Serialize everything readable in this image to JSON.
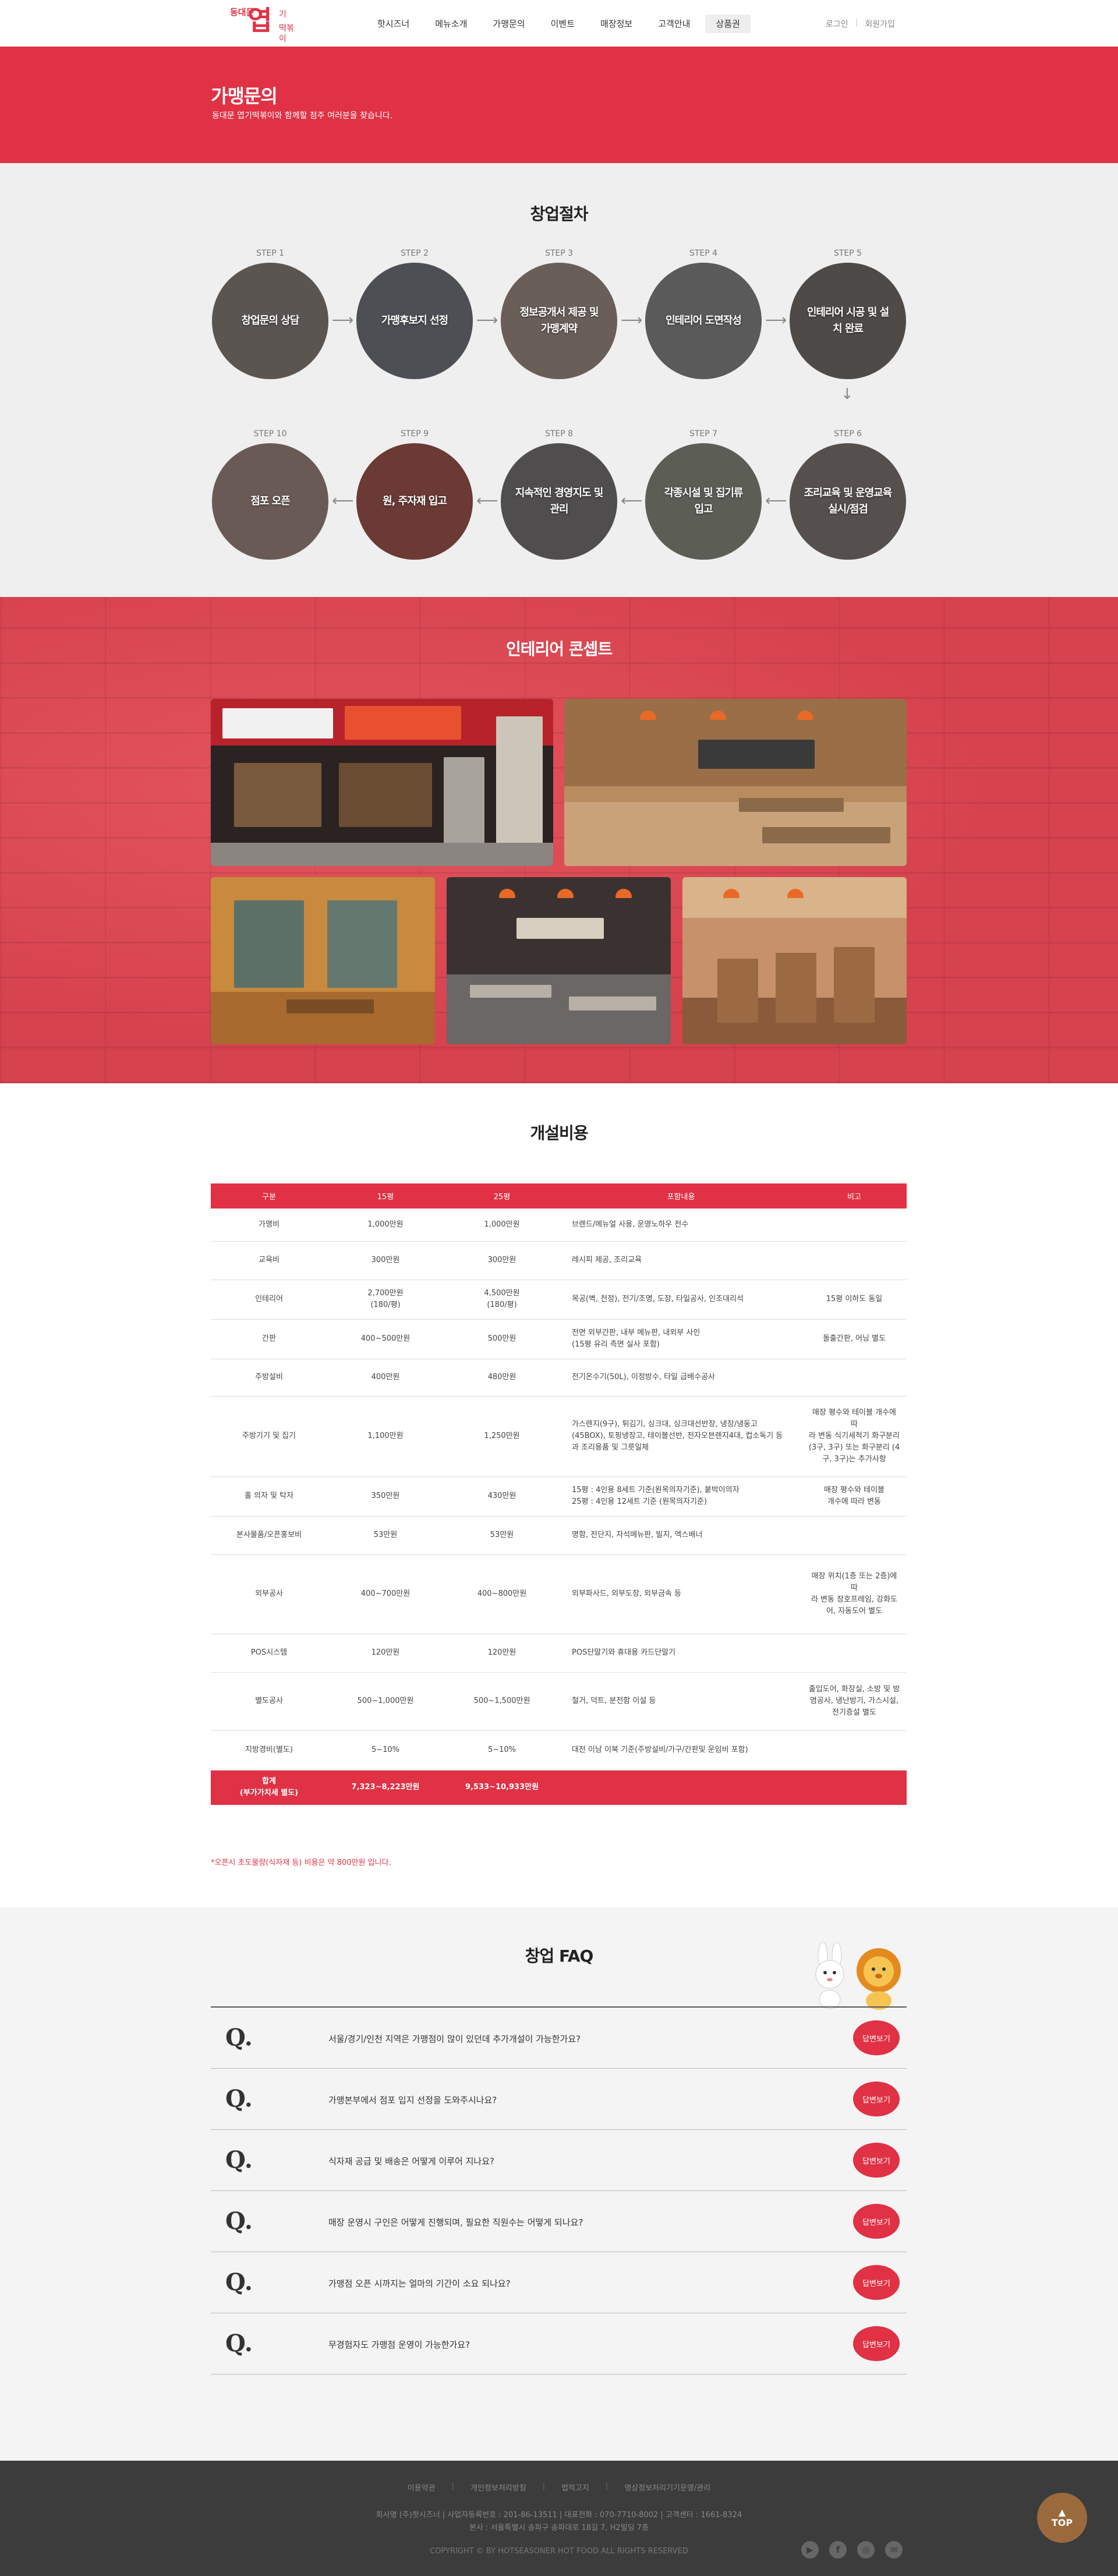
{
  "header": {
    "logo": {
      "line1": "동대문",
      "main": "엽",
      "right1": "기",
      "right2": "떡볶이"
    },
    "nav": [
      {
        "label": "핫시즈너"
      },
      {
        "label": "메뉴소개"
      },
      {
        "label": "가맹문의"
      },
      {
        "label": "이벤트"
      },
      {
        "label": "매장정보"
      },
      {
        "label": "고객안내"
      },
      {
        "label": "상품권"
      }
    ],
    "login": "로그인",
    "join": "회원가입"
  },
  "hero": {
    "title": "가맹문의",
    "subtitle": "동대문 엽기떡볶이와 함께할 점주 여러분을 찾습니다."
  },
  "process": {
    "title": "창업절차",
    "steps": [
      {
        "num": "STEP 1",
        "label": "창업문의 상담",
        "color": "#5b5552"
      },
      {
        "num": "STEP 2",
        "label": "가맹후보지 선정",
        "color": "#4d4f55"
      },
      {
        "num": "STEP 3",
        "label": "정보공개서 제공 및 가맹계약",
        "color": "#6a5e58"
      },
      {
        "num": "STEP 4",
        "label": "인테리어 도면작성",
        "color": "#5a5a5a"
      },
      {
        "num": "STEP 5",
        "label": "인테리어 시공 및 설치 완료",
        "color": "#4e4a48"
      },
      {
        "num": "STEP 6",
        "label": "조리교육 및 운영교육 실시/점검",
        "color": "#55504d"
      },
      {
        "num": "STEP 7",
        "label": "각종시설 및 집기류 입고",
        "color": "#5c5d55"
      },
      {
        "num": "STEP 8",
        "label": "지속적인 경영지도 및 관리",
        "color": "#4f4d4d"
      },
      {
        "num": "STEP 9",
        "label": "원, 주자재 입고",
        "color": "#6b3a35"
      },
      {
        "num": "STEP 10",
        "label": "점포 오픈",
        "color": "#6a5a55"
      }
    ]
  },
  "interior": {
    "title": "인테리어 콘셉트"
  },
  "cost": {
    "title": "개설비용",
    "headers": [
      "구분",
      "15평",
      "25평",
      "포함내용",
      "비고"
    ],
    "rows": [
      [
        "가맹비",
        "1,000만원",
        "1,000만원",
        "브랜드/메뉴얼 사용, 운영노하우 전수",
        ""
      ],
      [
        "교육비",
        "300만원",
        "300만원",
        "레시피 제공, 조리교육",
        ""
      ],
      [
        "인테리어",
        "2,700만원\n(180/평)",
        "4,500만원\n(180/평)",
        "목공(벽, 천정), 전기/조명, 도장, 타일공사, 인조대리석",
        "15평 이하도 동일"
      ],
      [
        "간판",
        "400~500만원",
        "500만원",
        "전면 외부간판, 내부 메뉴판, 내외부 사인\n(15평 유리 측면 실사 포함)",
        "돌출간판, 어닝 별도"
      ],
      [
        "주방설비",
        "400만원",
        "480만원",
        "전기온수기(50L), 이정방수, 타일 급배수공사",
        ""
      ],
      [
        "주방기기 및 집기",
        "1,100만원",
        "1,250만원",
        "가스렌지(9구), 튀김기, 싱크대, 싱크대선반장, 냉장/냉동고\n(45BOX), 토핑냉장고, 테이블선반, 전자오븐렌지4대, 컵소독기 등\n과 조리용품 및 그릇일체",
        "매장 평수와 테이블 개수에 따\n라 변동 식기세척기 화구분리\n(3구, 3구) 또는 화구분리 (4\n구, 3구)는 추가사항"
      ],
      [
        "홀 의자 및 탁자",
        "350만원",
        "430만원",
        "15평 : 4인용 8세트 기준(원목의자기준), 붙박이의자\n25평 : 4인용 12세트 기준 (원목의자기준)",
        "매장 평수와 테이블\n개수에 따라 변동"
      ],
      [
        "본사물품/오픈홍보비",
        "53만원",
        "53만원",
        "명함, 전단지, 자석메뉴판, 빌지, 엑스배너",
        ""
      ],
      [
        "외부공사",
        "400~700만원",
        "400~800만원",
        "외부파사드, 외부도장, 외부금속 등",
        "매장 위치(1층 또는 2층)에 따\n라 변동 장호프레임, 강화도\n어, 자동도어 별도"
      ],
      [
        "POS시스템",
        "120만원",
        "120만원",
        "POS단말기와 휴대용 카드단말기",
        ""
      ],
      [
        "별도공사",
        "500~1,000만원",
        "500~1,500만원",
        "철거, 덕트, 분전함 이설 등",
        "출입도어, 화장실, 소방 및 방\n염공사, 냉난방기, 가스시설,\n전기증설 별도"
      ],
      [
        "지방경비(별도)",
        "5~10%",
        "5~10%",
        "대전 이남 이북 기준(주방설비/가구/간판및 운임비 포함)",
        ""
      ]
    ],
    "total": [
      "합계\n(부가가치세 별도)",
      "7,323~8,223만원",
      "9,533~10,933만원",
      "",
      ""
    ],
    "note": "*오픈시 초도물량(식자재 등) 비용은 약 800만원 입니다."
  },
  "faq": {
    "title": "창업 FAQ",
    "q_mark": "Q.",
    "button_label": "답변보기",
    "items": [
      {
        "question": "서울/경기/인천 지역은 가맹점이 많이 있던데 추가개설이 가능한가요?"
      },
      {
        "question": "가맹본부에서 점포 입지 선정을 도와주시나요?"
      },
      {
        "question": "식자재 공급 및 배송은 어떻게 이루어 지나요?"
      },
      {
        "question": "매장 운영시 구인은 어떻게 진행되며, 필요한 직원수는 어떻게 되나요?"
      },
      {
        "question": "가맹점 오픈 시까지는 얼마의 기간이 소요 되나요?"
      },
      {
        "question": "무경험자도 가맹점 운영이 가능한가요?"
      }
    ]
  },
  "footer": {
    "links": [
      "이용약관",
      "개인정보처리방침",
      "법적고지",
      "영상정보처리기기운영/관리"
    ],
    "info1": "회사명 (주)핫시즈너  |  사업자등록번호 : 201-86-13511  |  대표전화 : 070-7710-8002  |  고객센터 : 1661-8324",
    "info2": "본사 : 서울특별시 송파구 송파대로 18길 7, H2빌딩 7층",
    "copyright": "COPYRIGHT © BY HOTSEASONER HOT FOOD ALL RIGHTS RESERVED",
    "sns": [
      "youtube-icon",
      "facebook-icon",
      "instagram-icon",
      "talk-icon"
    ],
    "top_label": "TOP"
  },
  "colors": {
    "brand_red": "#e03145",
    "footer_bg": "#3c3c3c",
    "top_button": "#9b6a3c"
  }
}
